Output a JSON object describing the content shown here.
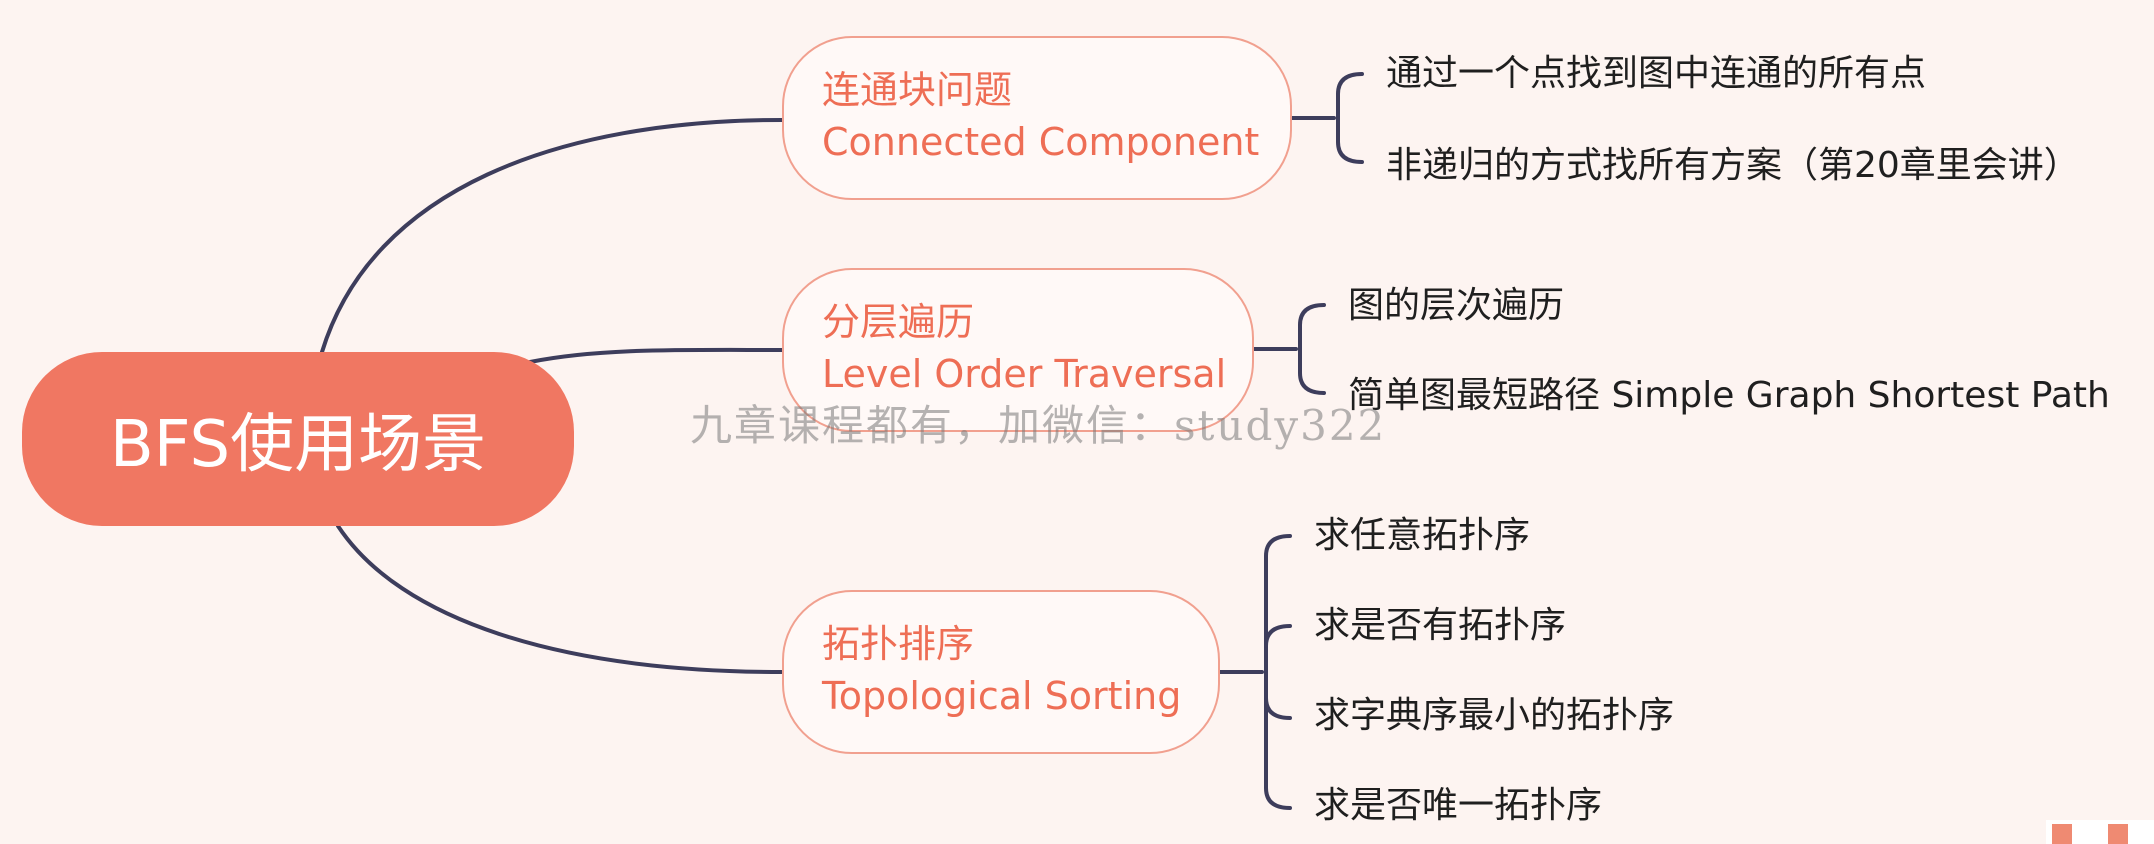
{
  "root": {
    "label": "BFS使用场景"
  },
  "branches": [
    {
      "label_zh": "连通块问题",
      "label_en": "Connected Component",
      "leaves": [
        "通过一个点找到图中连通的所有点",
        "非递归的方式找所有方案（第20章里会讲）"
      ]
    },
    {
      "label_zh": "分层遍历",
      "label_en": "Level Order Traversal",
      "leaves": [
        "图的层次遍历",
        "简单图最短路径 Simple Graph Shortest Path"
      ]
    },
    {
      "label_zh": "拓扑排序",
      "label_en": "Topological Sorting",
      "leaves": [
        "求任意拓扑序",
        "求是否有拓扑序",
        "求字典序最小的拓扑序",
        "求是否唯一拓扑序"
      ]
    }
  ],
  "watermark": "九章课程都有，加微信：study322",
  "colors": {
    "root_fill": "#f07762",
    "branch_border": "#f1a08f",
    "branch_text": "#ee6e55",
    "connector": "#3d3d5c",
    "background": "#fdf4f1"
  }
}
